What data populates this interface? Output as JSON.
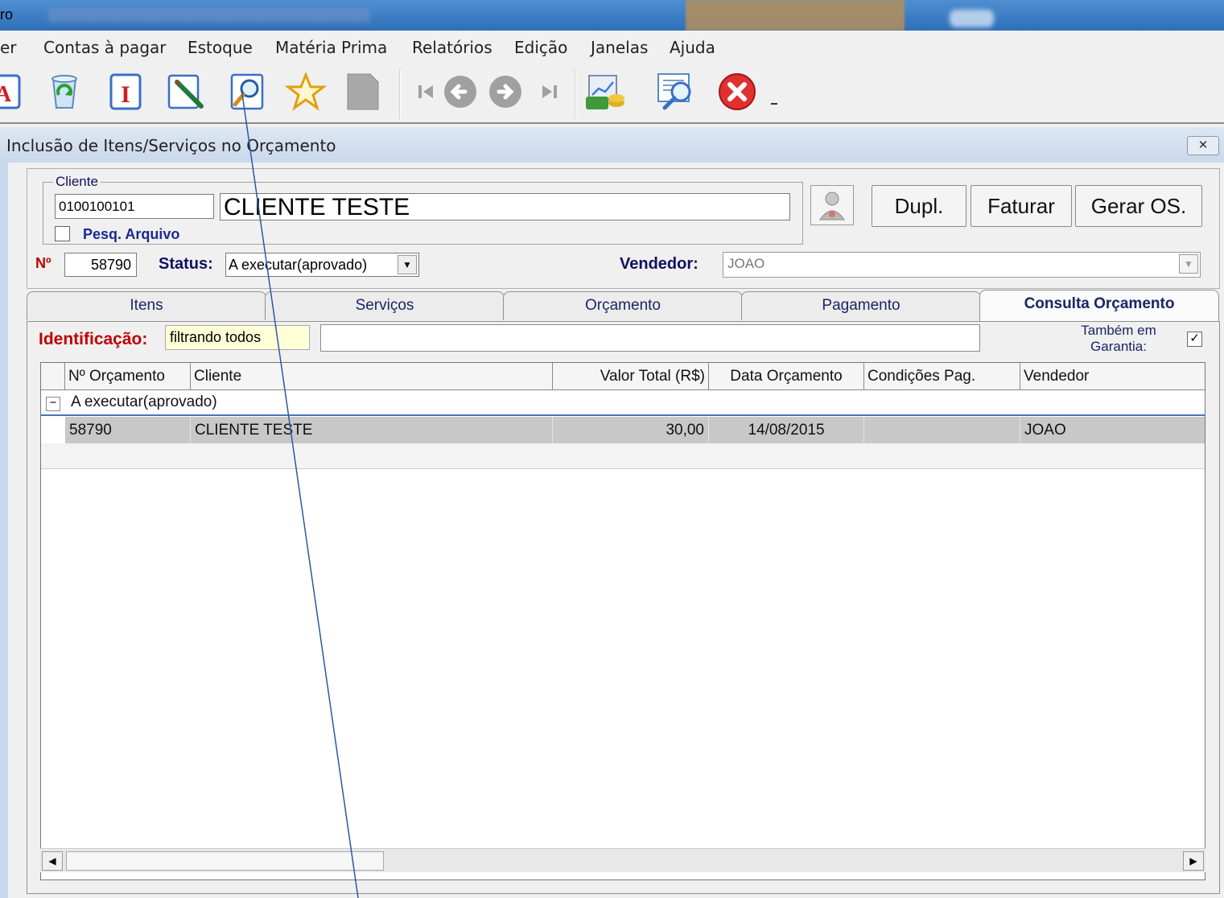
{
  "window": {
    "title_fragment": "ro"
  },
  "menu": [
    {
      "label": "er"
    },
    {
      "label": "Contas à pagar"
    },
    {
      "label": "Estoque"
    },
    {
      "label": "Matéria Prima"
    },
    {
      "label": "Relatórios"
    },
    {
      "label": "Edição"
    },
    {
      "label": "Janelas"
    },
    {
      "label": "Ajuda"
    }
  ],
  "toolbar": {
    "icons": [
      "text-icon",
      "recycle-icon",
      "insert-icon",
      "edit-icon",
      "search-icon",
      "favorite-star-icon",
      "save-icon",
      "first-record-icon",
      "previous-icon",
      "next-icon",
      "last-record-icon",
      "cash-report-icon",
      "preview-icon",
      "close-error-icon"
    ],
    "accent_red": "#e03030"
  },
  "child": {
    "title": "Inclusão de Itens/Serviços no Orçamento",
    "close_label": "✕"
  },
  "cliente": {
    "legend": "Cliente",
    "code": "0100100101",
    "name": "CLIENTE TESTE",
    "pesq_label": "Pesq. Arquivo"
  },
  "buttons": {
    "dupl": "Dupl.",
    "faturar": "Faturar",
    "gerar_os": "Gerar OS."
  },
  "numero": {
    "label": "Nº",
    "value": "58790"
  },
  "status": {
    "label": "Status:",
    "value": "A executar(aprovado)"
  },
  "vendedor": {
    "label": "Vendedor:",
    "value": "JOAO"
  },
  "tabs": [
    {
      "label": "Itens"
    },
    {
      "label": "Serviços"
    },
    {
      "label": "Orçamento"
    },
    {
      "label": "Pagamento"
    },
    {
      "label": "Consulta Orçamento"
    }
  ],
  "filter": {
    "ident_label": "Identificação:",
    "ident_value": "filtrando todos",
    "search_value": "",
    "garantia_label": "Também em Garantia:",
    "garantia_checked": "✓"
  },
  "grid": {
    "columns": [
      "Nº Orçamento",
      "Cliente",
      "Valor Total (R$)",
      "Data Orçamento",
      "Condições Pag.",
      "Vendedor"
    ],
    "group": {
      "toggle": "−",
      "label": "A executar(aprovado)"
    },
    "rows": [
      [
        "58790",
        "CLIENTE TESTE",
        "30,00",
        "14/08/2015",
        "",
        "JOAO"
      ]
    ]
  },
  "scroll": {
    "left": "◀",
    "right": "▶"
  }
}
